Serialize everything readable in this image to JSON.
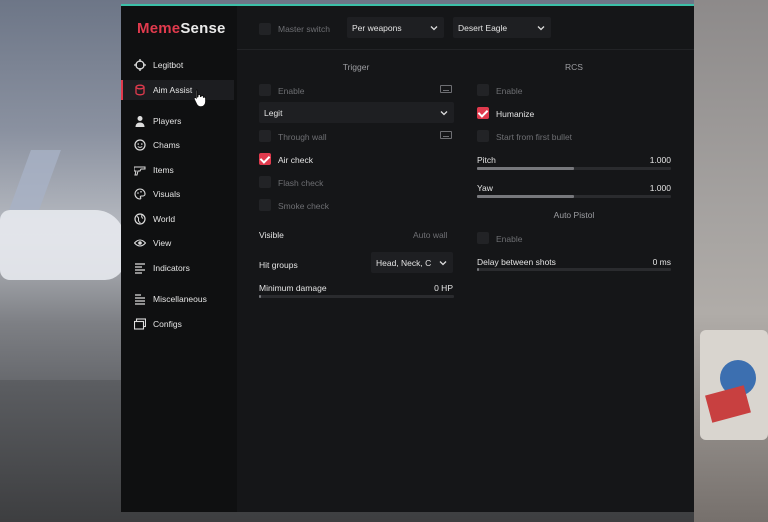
{
  "app": {
    "logo_part1": "Meme",
    "logo_part2": "Sense",
    "accent": "#e03a4d",
    "top_border": "#3cc0a8"
  },
  "sidebar": {
    "items": [
      {
        "label": "Legitbot",
        "icon": "crosshair-icon",
        "active": false
      },
      {
        "label": "Aim Assist",
        "icon": "cylinder-icon",
        "active": true
      },
      {
        "label": "Players",
        "icon": "person-icon",
        "active": false
      },
      {
        "label": "Chams",
        "icon": "smiley-icon",
        "active": false
      },
      {
        "label": "Items",
        "icon": "weapon-icon",
        "active": false
      },
      {
        "label": "Visuals",
        "icon": "palette-icon",
        "active": false
      },
      {
        "label": "World",
        "icon": "globe-icon",
        "active": false
      },
      {
        "label": "View",
        "icon": "eye-icon",
        "active": false
      },
      {
        "label": "Indicators",
        "icon": "list-icon",
        "active": false
      },
      {
        "label": "Miscellaneous",
        "icon": "menu-icon",
        "active": false
      },
      {
        "label": "Configs",
        "icon": "folder-icon",
        "active": false
      }
    ]
  },
  "topbar": {
    "master_switch_label": "Master switch",
    "master_switch_checked": false,
    "mode_select": "Per weapons",
    "weapon_select": "Desert Eagle"
  },
  "trigger": {
    "title": "Trigger",
    "enable_label": "Enable",
    "mode_select": "Legit",
    "through_wall_label": "Through wall",
    "air_check_label": "Air check",
    "flash_check_label": "Flash check",
    "smoke_check_label": "Smoke check",
    "visible_label": "Visible",
    "visible_value": "Auto wall",
    "hit_groups_label": "Hit groups",
    "hit_groups_value": "Head, Neck, C",
    "min_damage_label": "Minimum damage",
    "min_damage_value": "0 HP",
    "min_damage_fraction": 0.0
  },
  "rcs": {
    "title": "RCS",
    "enable_label": "Enable",
    "humanize_label": "Humanize",
    "start_label": "Start from first bullet",
    "pitch_label": "Pitch",
    "pitch_value": "1.000",
    "pitch_fraction": 0.5,
    "yaw_label": "Yaw",
    "yaw_value": "1.000",
    "yaw_fraction": 0.5
  },
  "auto_pistol": {
    "title": "Auto Pistol",
    "enable_label": "Enable",
    "delay_label": "Delay between shots",
    "delay_value": "0 ms",
    "delay_fraction": 0.0
  }
}
